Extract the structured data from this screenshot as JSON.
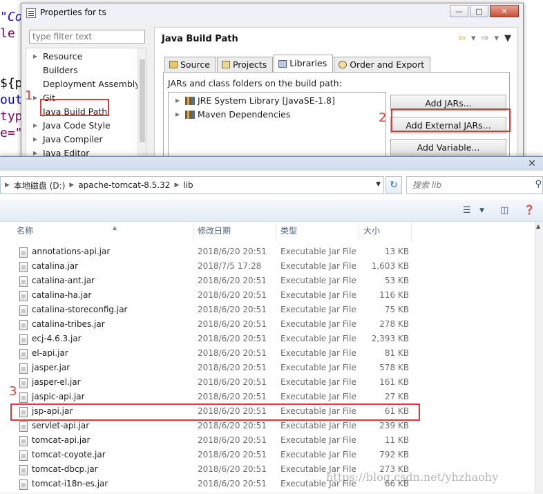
{
  "editor": {
    "lines": [
      "\"Co",
      "le",
      "${p",
      "out",
      "typ",
      "e=\""
    ]
  },
  "dialog": {
    "title": "Properties for ts",
    "filter_placeholder": "type filter text",
    "tree": [
      "Resource",
      "Builders",
      "Deployment Assembly",
      "Git",
      "Java Build Path",
      "Java Code Style",
      "Java Compiler",
      "Java Editor"
    ],
    "page_title": "Java Build Path",
    "tabs": [
      "Source",
      "Projects",
      "Libraries",
      "Order and Export"
    ],
    "active_tab": "Libraries",
    "jars_label": "JARs and class folders on the build path:",
    "libraries": [
      "JRE System Library [JavaSE-1.8]",
      "Maven Dependencies"
    ],
    "buttons": [
      "Add JARs...",
      "Add External JARs...",
      "Add Variable..."
    ]
  },
  "explorer": {
    "path": [
      "本地磁盘 (D:)",
      "apache-tomcat-8.5.32",
      "lib"
    ],
    "search_placeholder": "搜索 lib",
    "columns": {
      "name": "名称",
      "date": "修改日期",
      "type": "类型",
      "size": "大小"
    },
    "files": [
      {
        "name": "annotations-api.jar",
        "date": "2018/6/20 20:51",
        "type": "Executable Jar File",
        "size": "13 KB"
      },
      {
        "name": "catalina.jar",
        "date": "2018/7/5 17:28",
        "type": "Executable Jar File",
        "size": "1,603 KB"
      },
      {
        "name": "catalina-ant.jar",
        "date": "2018/6/20 20:51",
        "type": "Executable Jar File",
        "size": "53 KB"
      },
      {
        "name": "catalina-ha.jar",
        "date": "2018/6/20 20:51",
        "type": "Executable Jar File",
        "size": "116 KB"
      },
      {
        "name": "catalina-storeconfig.jar",
        "date": "2018/6/20 20:51",
        "type": "Executable Jar File",
        "size": "75 KB"
      },
      {
        "name": "catalina-tribes.jar",
        "date": "2018/6/20 20:51",
        "type": "Executable Jar File",
        "size": "278 KB"
      },
      {
        "name": "ecj-4.6.3.jar",
        "date": "2018/6/20 20:51",
        "type": "Executable Jar File",
        "size": "2,393 KB"
      },
      {
        "name": "el-api.jar",
        "date": "2018/6/20 20:51",
        "type": "Executable Jar File",
        "size": "81 KB"
      },
      {
        "name": "jasper.jar",
        "date": "2018/6/20 20:51",
        "type": "Executable Jar File",
        "size": "578 KB"
      },
      {
        "name": "jasper-el.jar",
        "date": "2018/6/20 20:51",
        "type": "Executable Jar File",
        "size": "161 KB"
      },
      {
        "name": "jaspic-api.jar",
        "date": "2018/6/20 20:51",
        "type": "Executable Jar File",
        "size": "27 KB"
      },
      {
        "name": "jsp-api.jar",
        "date": "2018/6/20 20:51",
        "type": "Executable Jar File",
        "size": "61 KB"
      },
      {
        "name": "servlet-api.jar",
        "date": "2018/6/20 20:51",
        "type": "Executable Jar File",
        "size": "239 KB"
      },
      {
        "name": "tomcat-api.jar",
        "date": "2018/6/20 20:51",
        "type": "Executable Jar File",
        "size": "11 KB"
      },
      {
        "name": "tomcat-coyote.jar",
        "date": "2018/6/20 20:51",
        "type": "Executable Jar File",
        "size": "792 KB"
      },
      {
        "name": "tomcat-dbcp.jar",
        "date": "2018/6/20 20:51",
        "type": "Executable Jar File",
        "size": "273 KB"
      },
      {
        "name": "tomcat-i18n-es.jar",
        "date": "2018/6/20 20:51",
        "type": "Executable Jar File",
        "size": "66 KB"
      }
    ]
  },
  "annotations": {
    "step1": "1",
    "step2": "2",
    "step3": "3",
    "highlight_color": "#e53935"
  },
  "watermark": "https://blog.csdn.net/yhzhaohy"
}
